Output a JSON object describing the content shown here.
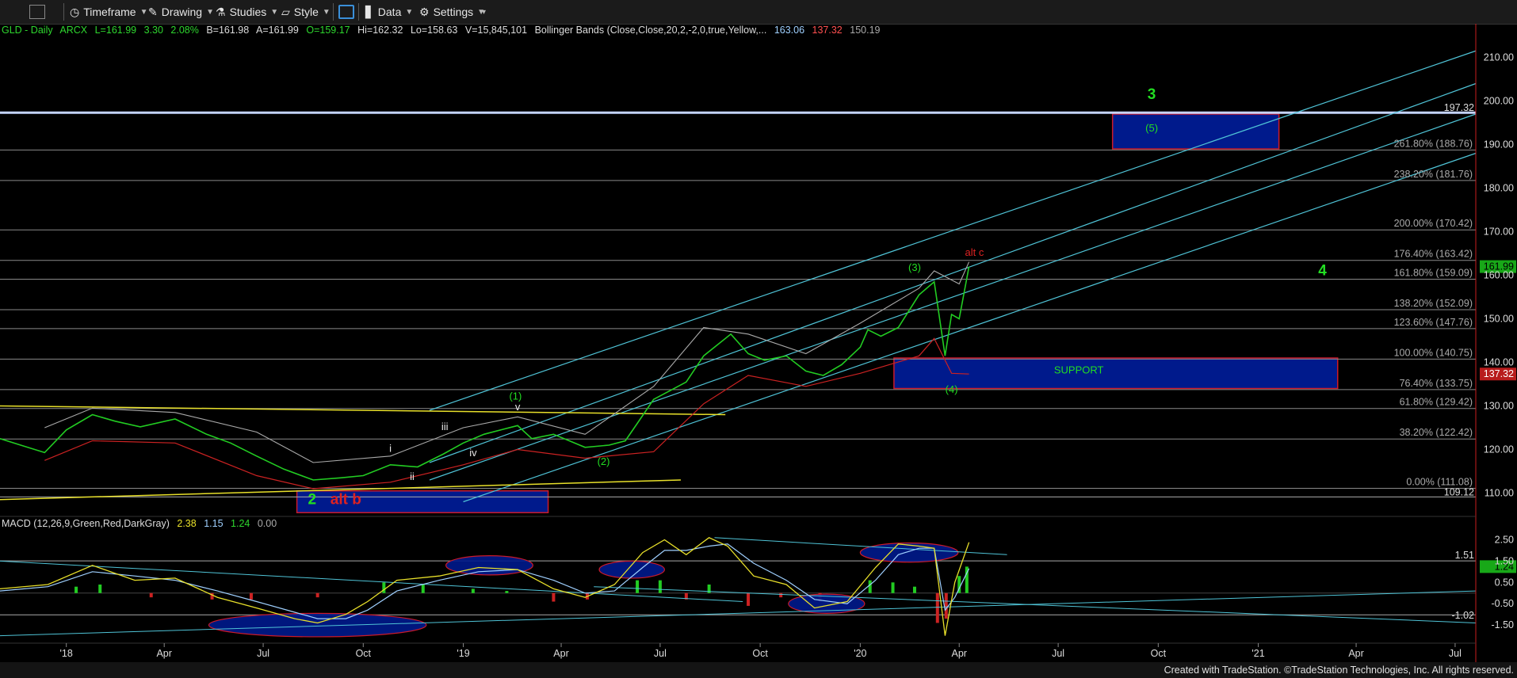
{
  "toolbar": {
    "timeframe": "Timeframe",
    "drawing": "Drawing",
    "studies": "Studies",
    "style": "Style",
    "data": "Data",
    "settings": "Settings"
  },
  "info": {
    "symbol": "GLD - Daily",
    "exchange": "ARCX",
    "last": "L=161.99",
    "change": "3.30",
    "change_pct": "2.08%",
    "bid": "B=161.98",
    "ask": "A=161.99",
    "open": "O=159.17",
    "high": "Hi=162.32",
    "low": "Lo=158.63",
    "volume": "V=15,845,101",
    "study": "Bollinger Bands (Close,Close,20,2,-2,0,true,Yellow,...",
    "bb_upper": "163.06",
    "bb_lower": "137.32",
    "bb_mid": "150.19"
  },
  "macd": {
    "label": "MACD (12,26,9,Green,Red,DarkGray)",
    "v1": "2.38",
    "v2": "1.15",
    "v3": "1.24",
    "v4": "0.00"
  },
  "colors": {
    "price_green": "#22cc22",
    "price_red": "#cc2222",
    "upper_band": "#aaaaaa",
    "lower_band": "#cc2222",
    "channel": "#4fc3d6",
    "trendline": "#e8e02a",
    "box_fill": "#001a8c",
    "box_stroke": "#cc1a2a",
    "wave_green": "#22dd22",
    "wave_red": "#dd2222"
  },
  "chart_data": {
    "type": "line",
    "title": "GLD - Daily",
    "price_axis": {
      "ylim": [
        105,
        215
      ],
      "ticks": [
        "210.00",
        "200.00",
        "190.00",
        "180.00",
        "170.00",
        "160.00",
        "150.00",
        "140.00",
        "130.00",
        "120.00",
        "110.00"
      ],
      "tick_values": [
        210,
        200,
        190,
        180,
        170,
        160,
        150,
        140,
        130,
        120,
        110
      ]
    },
    "x_axis": {
      "labels": [
        "'18",
        "Apr",
        "Jul",
        "Oct",
        "'19",
        "Apr",
        "Jul",
        "Oct",
        "'20",
        "Apr",
        "Jul",
        "Oct",
        "'21",
        "Apr",
        "Jul"
      ],
      "dates": [
        "2018-01-01",
        "2018-04-01",
        "2018-07-01",
        "2018-10-01",
        "2019-01-01",
        "2019-04-01",
        "2019-07-01",
        "2019-10-01",
        "2020-01-01",
        "2020-04-01",
        "2020-07-01",
        "2020-10-01",
        "2021-01-01",
        "2021-04-01",
        "2021-07-01"
      ]
    },
    "fib_levels": [
      {
        "label": "261.80% (188.76)",
        "value": 188.76
      },
      {
        "label": "238.20% (181.76)",
        "value": 181.76
      },
      {
        "label": "200.00% (170.42)",
        "value": 170.42
      },
      {
        "label": "176.40% (163.42)",
        "value": 163.42
      },
      {
        "label": "161.80% (159.09)",
        "value": 159.09
      },
      {
        "label": "138.20% (152.09)",
        "value": 152.09
      },
      {
        "label": "123.60% (147.76)",
        "value": 147.76
      },
      {
        "label": "100.00% (140.75)",
        "value": 140.75
      },
      {
        "label": "76.40% (133.75)",
        "value": 133.75
      },
      {
        "label": "61.80% (129.42)",
        "value": 129.42
      },
      {
        "label": "38.20% (122.42)",
        "value": 122.42
      },
      {
        "label": "0.00% (111.08)",
        "value": 111.08
      }
    ],
    "price_labels": [
      {
        "label": "197.32",
        "value": 197.32
      },
      {
        "label": "109.12",
        "value": 109.12
      }
    ],
    "last_price": {
      "label": "161.99",
      "value": 161.99
    },
    "lower_band_last": {
      "label": "137.32",
      "value": 137.32
    },
    "price_series": {
      "name": "GLD",
      "x": [
        "2017-11-01",
        "2017-11-20",
        "2017-12-12",
        "2018-01-01",
        "2018-01-25",
        "2018-02-15",
        "2018-03-10",
        "2018-04-11",
        "2018-05-10",
        "2018-06-01",
        "2018-06-25",
        "2018-07-20",
        "2018-08-16",
        "2018-09-10",
        "2018-10-01",
        "2018-10-26",
        "2018-11-20",
        "2018-12-14",
        "2019-01-01",
        "2019-01-20",
        "2019-02-20",
        "2019-03-05",
        "2019-03-25",
        "2019-04-23",
        "2019-05-15",
        "2019-05-30",
        "2019-06-10",
        "2019-06-25",
        "2019-07-10",
        "2019-07-25",
        "2019-08-10",
        "2019-09-04",
        "2019-09-20",
        "2019-10-05",
        "2019-10-25",
        "2019-11-12",
        "2019-11-28",
        "2019-12-15",
        "2020-01-01",
        "2020-01-08",
        "2020-01-20",
        "2020-02-05",
        "2020-02-24",
        "2020-03-09",
        "2020-03-19",
        "2020-03-25",
        "2020-04-01",
        "2020-04-10"
      ],
      "values": [
        122.5,
        121.0,
        119.3,
        124.5,
        128.0,
        126.5,
        125.2,
        127.0,
        123.5,
        121.5,
        118.5,
        115.5,
        113.0,
        113.5,
        114.0,
        116.5,
        116.0,
        119.0,
        121.5,
        123.5,
        125.5,
        122.5,
        123.5,
        120.5,
        121.0,
        122.0,
        126.0,
        131.5,
        133.5,
        135.5,
        141.5,
        146.5,
        142.0,
        140.5,
        141.5,
        138.0,
        137.0,
        139.5,
        143.5,
        147.5,
        146.0,
        148.0,
        155.5,
        158.5,
        141.5,
        151.0,
        150.0,
        161.99
      ]
    },
    "upper_band_series": {
      "x": [
        "2017-12-12",
        "2018-01-25",
        "2018-04-11",
        "2018-06-25",
        "2018-08-16",
        "2018-10-26",
        "2019-01-01",
        "2019-02-20",
        "2019-04-23",
        "2019-06-25",
        "2019-08-10",
        "2019-09-20",
        "2019-11-12",
        "2020-01-01",
        "2020-02-24",
        "2020-03-09",
        "2020-04-01",
        "2020-04-10"
      ],
      "values": [
        125.0,
        129.5,
        128.5,
        124.0,
        117.0,
        118.5,
        125.0,
        127.5,
        123.5,
        134.5,
        148.0,
        146.5,
        142.0,
        149.0,
        157.0,
        161.0,
        158.0,
        163.06
      ]
    },
    "lower_band_series": {
      "x": [
        "2017-12-12",
        "2018-01-25",
        "2018-04-11",
        "2018-06-25",
        "2018-08-16",
        "2018-10-26",
        "2019-01-01",
        "2019-02-20",
        "2019-04-23",
        "2019-06-25",
        "2019-08-10",
        "2019-09-20",
        "2019-11-12",
        "2020-01-01",
        "2020-02-24",
        "2020-03-09",
        "2020-03-25",
        "2020-04-10"
      ],
      "values": [
        117.5,
        122.0,
        121.5,
        114.0,
        111.0,
        112.5,
        116.5,
        120.0,
        118.0,
        119.5,
        130.5,
        137.0,
        134.5,
        137.5,
        141.5,
        145.5,
        137.5,
        137.32
      ]
    },
    "channel_lines": [
      {
        "from": [
          "2018-12-01",
          129.0
        ],
        "to": [
          "2021-07-20",
          211.5
        ]
      },
      {
        "from": [
          "2018-12-01",
          117.0
        ],
        "to": [
          "2021-07-20",
          204.0
        ]
      },
      {
        "from": [
          "2018-12-01",
          113.0
        ],
        "to": [
          "2021-07-20",
          197.0
        ]
      },
      {
        "from": [
          "2019-01-01",
          108.0
        ],
        "to": [
          "2021-07-20",
          188.0
        ]
      }
    ],
    "trend_lines": [
      {
        "from": [
          "2017-11-01",
          130.0
        ],
        "to": [
          "2019-08-30",
          128.0
        ]
      },
      {
        "from": [
          "2017-11-01",
          108.5
        ],
        "to": [
          "2019-07-20",
          113.0
        ]
      },
      {
        "from": [
          "2019-08-20",
          130.0
        ],
        "to": [
          "2019-08-20",
          130.0
        ]
      }
    ],
    "zones": [
      {
        "label": "(5)",
        "x": [
          "2020-08-20",
          "2021-01-20"
        ],
        "y": [
          189.0,
          197.0
        ]
      },
      {
        "label": "SUPPORT",
        "x": [
          "2020-02-01",
          "2021-03-15"
        ],
        "y": [
          134.0,
          141.0
        ]
      },
      {
        "label": "",
        "x": [
          "2018-08-01",
          "2019-03-20"
        ],
        "y": [
          105.5,
          110.5
        ]
      }
    ],
    "wave_labels": [
      {
        "label": "3",
        "x": "2020-09-25",
        "y": 200.5,
        "color": "green",
        "size": "large"
      },
      {
        "label": "(5)",
        "x": "2020-09-25",
        "y": 193.0,
        "color": "green",
        "size": "small"
      },
      {
        "label": "4",
        "x": "2021-03-01",
        "y": 160.0,
        "color": "green",
        "size": "large"
      },
      {
        "label": "alt c",
        "x": "2020-04-15",
        "y": 164.5,
        "color": "red",
        "size": "small"
      },
      {
        "label": "(3)",
        "x": "2020-02-20",
        "y": 161.0,
        "color": "green",
        "size": "small"
      },
      {
        "label": "(4)",
        "x": "2020-03-25",
        "y": 133.0,
        "color": "green",
        "size": "small"
      },
      {
        "label": "SUPPORT",
        "x": "2020-07-20",
        "y": 137.5,
        "color": "green",
        "size": "small"
      },
      {
        "label": "(1)",
        "x": "2019-02-18",
        "y": 131.5,
        "color": "green",
        "size": "small"
      },
      {
        "label": "v",
        "x": "2019-02-20",
        "y": 129.0,
        "color": "white",
        "size": "small"
      },
      {
        "label": "iii",
        "x": "2018-12-15",
        "y": 124.5,
        "color": "white",
        "size": "small"
      },
      {
        "label": "iv",
        "x": "2019-01-10",
        "y": 118.5,
        "color": "white",
        "size": "small"
      },
      {
        "label": "i",
        "x": "2018-10-26",
        "y": 119.5,
        "color": "white",
        "size": "small"
      },
      {
        "label": "ii",
        "x": "2018-11-15",
        "y": 113.0,
        "color": "white",
        "size": "small"
      },
      {
        "label": "(2)",
        "x": "2019-05-10",
        "y": 116.5,
        "color": "green",
        "size": "small"
      },
      {
        "label": "2",
        "x": "2018-08-15",
        "y": 107.5,
        "color": "green",
        "size": "large"
      },
      {
        "label": "alt b",
        "x": "2018-09-15",
        "y": 107.5,
        "color": "red",
        "size": "large"
      }
    ],
    "macd_panel": {
      "ylim": [
        -2.2,
        3.0
      ],
      "ticks": [
        "2.50",
        "1.50",
        "0.50",
        "-0.50",
        "-1.50"
      ],
      "tick_values": [
        2.5,
        1.5,
        0.5,
        -0.5,
        -1.5
      ],
      "price_labels": [
        {
          "label": "1.51",
          "value": 1.51
        },
        {
          "label": "-1.02",
          "value": -1.02
        }
      ],
      "last_value": {
        "label": "1.24",
        "value": 1.24
      },
      "macd_series": {
        "x": [
          "2017-11-01",
          "2017-12-15",
          "2018-01-25",
          "2018-03-05",
          "2018-04-11",
          "2018-05-20",
          "2018-06-25",
          "2018-07-30",
          "2018-08-20",
          "2018-09-15",
          "2018-10-05",
          "2018-11-01",
          "2018-12-10",
          "2019-01-15",
          "2019-02-20",
          "2019-03-25",
          "2019-04-23",
          "2019-05-20",
          "2019-06-15",
          "2019-07-05",
          "2019-07-25",
          "2019-08-15",
          "2019-09-01",
          "2019-09-25",
          "2019-10-25",
          "2019-11-20",
          "2019-12-20",
          "2020-01-15",
          "2020-02-05",
          "2020-02-24",
          "2020-03-09",
          "2020-03-19",
          "2020-03-28",
          "2020-04-10"
        ],
        "values": [
          0.2,
          0.4,
          1.3,
          0.6,
          0.7,
          -0.2,
          -0.7,
          -1.2,
          -1.4,
          -1.0,
          -0.4,
          0.6,
          0.8,
          1.2,
          1.1,
          0.2,
          -0.2,
          0.4,
          1.9,
          2.5,
          1.8,
          2.6,
          2.2,
          0.8,
          0.4,
          -0.7,
          -0.4,
          1.2,
          2.3,
          2.2,
          2.1,
          -2.0,
          0.5,
          2.38
        ]
      },
      "signal_series": {
        "x": [
          "2017-11-01",
          "2017-12-15",
          "2018-01-25",
          "2018-03-05",
          "2018-04-11",
          "2018-05-20",
          "2018-06-25",
          "2018-07-30",
          "2018-08-20",
          "2018-09-15",
          "2018-10-05",
          "2018-11-01",
          "2018-12-10",
          "2019-01-15",
          "2019-02-20",
          "2019-03-25",
          "2019-04-23",
          "2019-05-20",
          "2019-06-15",
          "2019-07-05",
          "2019-07-25",
          "2019-08-15",
          "2019-09-01",
          "2019-09-25",
          "2019-10-25",
          "2019-11-20",
          "2019-12-20",
          "2020-01-15",
          "2020-02-05",
          "2020-02-24",
          "2020-03-09",
          "2020-03-19",
          "2020-03-28",
          "2020-04-10"
        ],
        "values": [
          0.1,
          0.3,
          1.0,
          0.8,
          0.6,
          0.1,
          -0.4,
          -0.9,
          -1.2,
          -1.2,
          -0.8,
          0.1,
          0.6,
          1.0,
          1.1,
          0.6,
          0.0,
          0.1,
          1.2,
          2.0,
          2.0,
          2.2,
          2.3,
          1.4,
          0.6,
          -0.3,
          -0.5,
          0.6,
          1.8,
          2.1,
          2.1,
          -0.8,
          -0.2,
          1.15
        ]
      },
      "histogram": {
        "x": [
          "2018-01-10",
          "2018-02-01",
          "2018-03-20",
          "2018-05-15",
          "2018-06-20",
          "2018-08-20",
          "2018-10-20",
          "2018-11-25",
          "2019-01-10",
          "2019-02-10",
          "2019-03-25",
          "2019-04-25",
          "2019-06-10",
          "2019-07-01",
          "2019-07-25",
          "2019-08-15",
          "2019-09-20",
          "2019-10-20",
          "2019-11-25",
          "2020-01-10",
          "2020-01-31",
          "2020-02-20",
          "2020-03-12",
          "2020-03-20",
          "2020-04-01",
          "2020-04-08"
        ],
        "values": [
          0.3,
          0.4,
          -0.2,
          -0.3,
          -0.3,
          -0.2,
          0.5,
          0.4,
          0.2,
          0.1,
          -0.4,
          -0.3,
          0.6,
          0.6,
          -0.3,
          0.4,
          -0.6,
          -0.2,
          -0.4,
          0.6,
          0.5,
          0.3,
          -1.4,
          -1.2,
          0.8,
          1.24
        ]
      },
      "trend_lines": [
        {
          "from": [
            "2017-11-01",
            1.5
          ],
          "to": [
            "2019-09-15",
            -0.4
          ]
        },
        {
          "from": [
            "2017-11-01",
            -2.0
          ],
          "to": [
            "2021-07-20",
            0.1
          ]
        },
        {
          "from": [
            "2019-08-20",
            2.6
          ],
          "to": [
            "2020-05-15",
            1.8
          ]
        },
        {
          "from": [
            "2019-05-01",
            0.3
          ],
          "to": [
            "2021-07-20",
            -1.4
          ]
        }
      ],
      "ellipses": [
        {
          "cx": "2018-08-20",
          "cy": -1.5,
          "rx_days": 100,
          "ry": 0.55
        },
        {
          "cx": "2019-01-25",
          "cy": 1.3,
          "rx_days": 40,
          "ry": 0.45
        },
        {
          "cx": "2019-06-05",
          "cy": 1.1,
          "rx_days": 30,
          "ry": 0.4
        },
        {
          "cx": "2019-12-01",
          "cy": -0.5,
          "rx_days": 35,
          "ry": 0.45
        },
        {
          "cx": "2020-02-15",
          "cy": 1.9,
          "rx_days": 45,
          "ry": 0.45
        }
      ]
    }
  },
  "footer": "Created with TradeStation. ©TradeStation Technologies, Inc. All rights reserved."
}
